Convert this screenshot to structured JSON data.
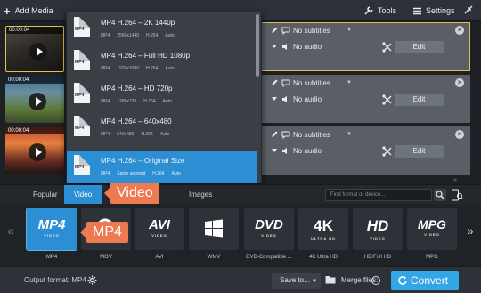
{
  "toolbar": {
    "add_media": "Add Media",
    "tools": "Tools",
    "settings": "Settings"
  },
  "files": [
    {
      "time": "00:00:04",
      "subtitles": "No subtitles",
      "audio": "No audio",
      "edit": "Edit"
    },
    {
      "time": "00:00:04",
      "subtitles": "No subtitles",
      "audio": "No audio",
      "edit": "Edit"
    },
    {
      "time": "00:00:04",
      "subtitles": "No subtitles",
      "audio": "No audio",
      "edit": "Edit"
    }
  ],
  "presets": [
    {
      "title": "MP4 H.264 – 2K 1440p",
      "icon": "MP4",
      "format": "MP4",
      "resolution": "2560x1440",
      "codec": "H.264",
      "bitrate": "Auto"
    },
    {
      "title": "MP4 H.264 – Full HD 1080p",
      "icon": "MP4",
      "format": "MP4",
      "resolution": "1920x1080",
      "codec": "H.264",
      "bitrate": "Auto"
    },
    {
      "title": "MP4 H.264 – HD 720p",
      "icon": "MP4",
      "format": "MP4",
      "resolution": "1280x720",
      "codec": "H.264",
      "bitrate": "Auto"
    },
    {
      "title": "MP4 H.264 – 640x480",
      "icon": "MP4",
      "format": "MP4",
      "resolution": "640x480",
      "codec": "H.264",
      "bitrate": "Auto"
    },
    {
      "title": "MP4 H.264 – Original Size",
      "icon": "MP4",
      "format": "MP4",
      "resolution": "Same as input",
      "codec": "H.264",
      "bitrate": "Auto"
    }
  ],
  "tabs": {
    "popular": "Popular",
    "video": "Video",
    "images": "Images",
    "search_placeholder": "Find format or device..."
  },
  "formats": [
    {
      "logo": "MP4",
      "sub": "VIDEO",
      "label": "MP4"
    },
    {
      "logo": "",
      "sub": "",
      "label": "MOV"
    },
    {
      "logo": "AVI",
      "sub": "VIDEO",
      "label": "AVI"
    },
    {
      "logo": "",
      "sub": "",
      "label": "WMV"
    },
    {
      "logo": "DVD",
      "sub": "VIDEO",
      "label": "DVD-Compatible ..."
    },
    {
      "logo": "4K",
      "sub": "ULTRA HD",
      "label": "4K Ultra HD"
    },
    {
      "logo": "HD",
      "sub": "VIDEO",
      "label": "HD/Full HD"
    },
    {
      "logo": "MPG",
      "sub": "VIDEO",
      "label": "MPG"
    }
  ],
  "callouts": {
    "video": "Video",
    "mp4": "MP4"
  },
  "bottom": {
    "output_format": "Output format: MP4",
    "save_to": "Save to...",
    "merge_files": "Merge files:",
    "convert": "Convert"
  },
  "colors": {
    "accent": "#2c8ed3",
    "convert": "#33a7e6",
    "callout": "#ee7a52",
    "selected_border": "#e5c04e"
  }
}
